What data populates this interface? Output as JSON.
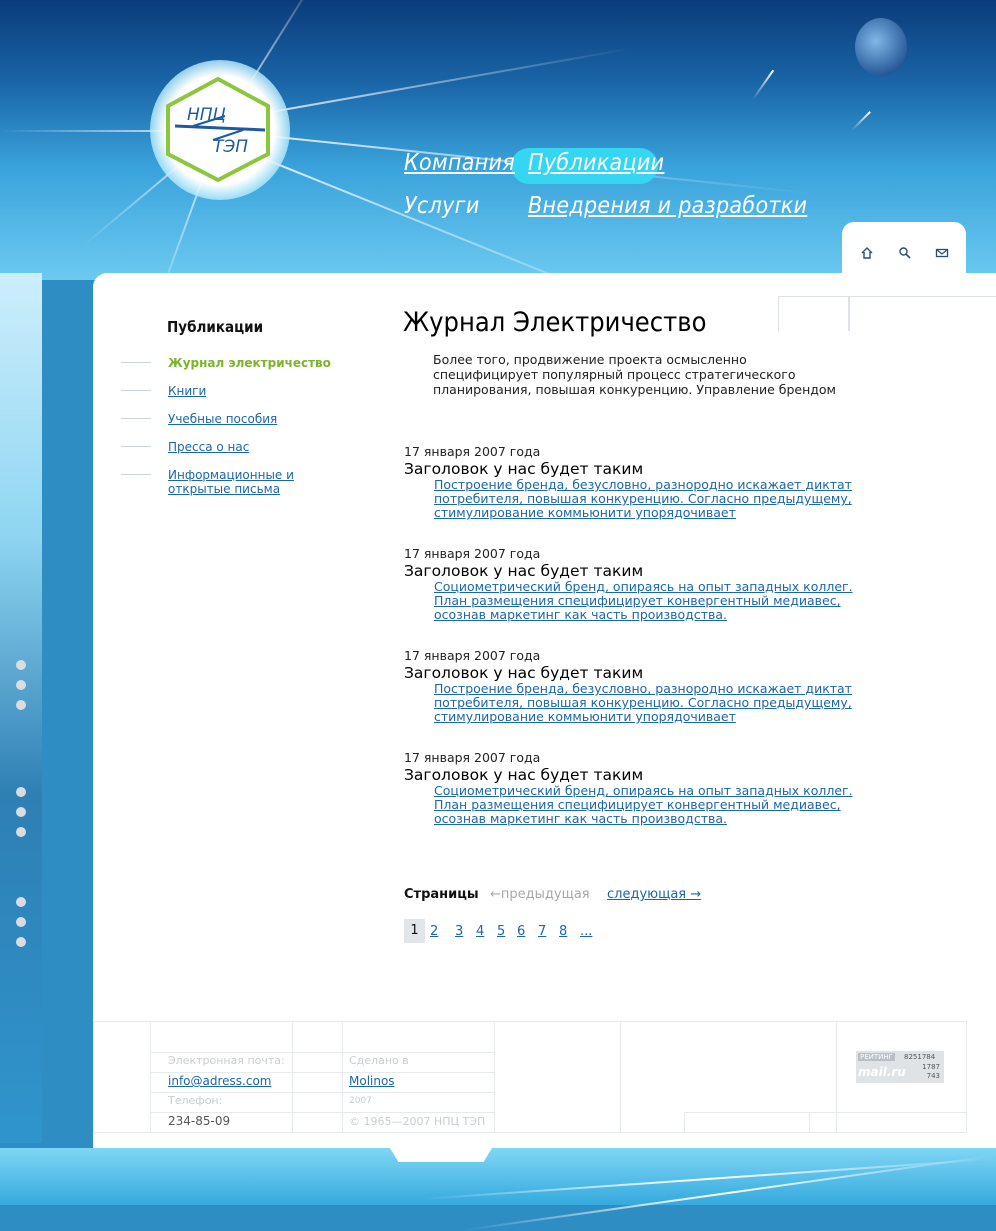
{
  "header": {
    "logo_line1": "НПЦ",
    "logo_line2": "ТЭП",
    "nav": [
      {
        "label": "Компания",
        "active": false
      },
      {
        "label": "Публикации",
        "active": true
      },
      {
        "label": "Услуги",
        "active": false
      },
      {
        "label": "Внедрения и разработки",
        "active": false
      }
    ],
    "icons": [
      "home-icon",
      "search-icon",
      "mail-icon"
    ]
  },
  "sidebar": {
    "title": "Публикации",
    "items": [
      {
        "label": "Журнал электричество",
        "active": true
      },
      {
        "label": "Книги",
        "active": false
      },
      {
        "label": "Учебные пособия",
        "active": false
      },
      {
        "label": "Пресса о нас",
        "active": false
      },
      {
        "label": "Информационные и открытые письма",
        "active": false
      }
    ]
  },
  "main": {
    "title": "Журнал Электричество",
    "intro": "Более того, продвижение проекта осмысленно специфицирует популярный процесс стратегического планирования, повышая конкуренцию. Управление брендом",
    "news": [
      {
        "date": "17 января 2007 года",
        "title": "Заголовок у нас будет таким",
        "text": "Построение бренда, безусловно, разнородно искажает диктат потребителя, повышая конкуренцию. Согласно предыдущему, стимулирование коммьюнити упорядочивает"
      },
      {
        "date": "17 января 2007 года",
        "title": "Заголовок у нас будет таким",
        "text": "Социометрический бренд, опираясь на опыт западных коллег. План размещения специфицирует конвергентный медиавес, осознав маркетинг как часть производства."
      },
      {
        "date": "17 января 2007 года",
        "title": "Заголовок у нас будет таким",
        "text": "Построение бренда, безусловно, разнородно искажает диктат потребителя, повышая конкуренцию. Согласно предыдущему, стимулирование коммьюнити упорядочивает"
      },
      {
        "date": "17 января 2007 года",
        "title": "Заголовок у нас будет таким",
        "text": "Социометрический бренд, опираясь на опыт западных коллег. План размещения специфицирует конвергентный медиавес, осознав маркетинг как часть производства."
      }
    ]
  },
  "pager": {
    "label": "Страницы",
    "prev": "←предыдущая",
    "next": "следующая →",
    "current": "1",
    "pages": [
      "2",
      "3",
      "4",
      "5",
      "6",
      "7",
      "8",
      "..."
    ]
  },
  "footer": {
    "email_label": "Электронная почта:",
    "email": "info@adress.com",
    "phone_label": "Телефон:",
    "phone": "234-85-09",
    "made_label": "Сделано в",
    "made_by": "Molinos",
    "year": "2007",
    "copyright": "© 1965—2007 НПЦ ТЭП",
    "counter": {
      "brand": "mail.ru",
      "rating_label": "РЕЙТИНГ",
      "v1": "8251784",
      "v2": "1787",
      "v3": "743"
    }
  },
  "colors": {
    "link": "#1b67a8",
    "active": "#7ab627",
    "accent": "#35d6f2"
  }
}
